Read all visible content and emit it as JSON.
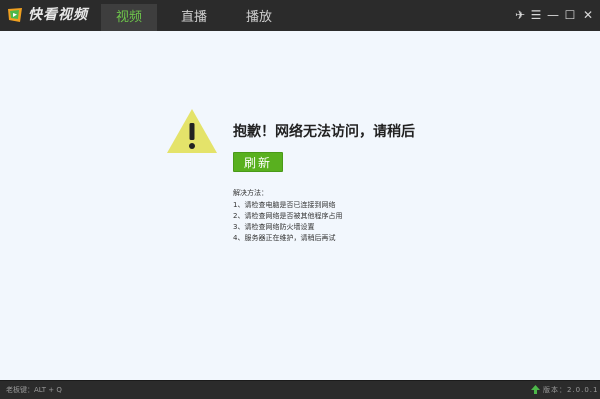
{
  "app": {
    "title": "快看视频"
  },
  "tabs": [
    {
      "label": "视频",
      "active": true
    },
    {
      "label": "直播",
      "active": false
    },
    {
      "label": "播放",
      "active": false
    }
  ],
  "window_controls": {
    "pin": "✈",
    "menu": "☰",
    "minimize": "—",
    "maximize": "☐",
    "close": "✕"
  },
  "error": {
    "title": "抱歉！网络无法访问，请稍后",
    "refresh_label": "刷新",
    "solution_heading": "解决方法：",
    "solutions": [
      "1、请检查电脑是否已连接到网络",
      "2、请检查网络是否被其他程序占用",
      "3、请检查网络防火墙设置",
      "4、服务器正在维护，请稍后再试"
    ]
  },
  "statusbar": {
    "hotkey": "老板键：ALT + Q",
    "version": "版本：2.0.0.1"
  },
  "colors": {
    "accent": "#6ec64b",
    "button": "#59b01f",
    "warning": "#e4e36a",
    "titlebar": "#2b2b2b"
  },
  "icons": {
    "logo": "app-logo-icon",
    "warning": "warning-icon",
    "version": "upgrade-arrow-icon"
  }
}
